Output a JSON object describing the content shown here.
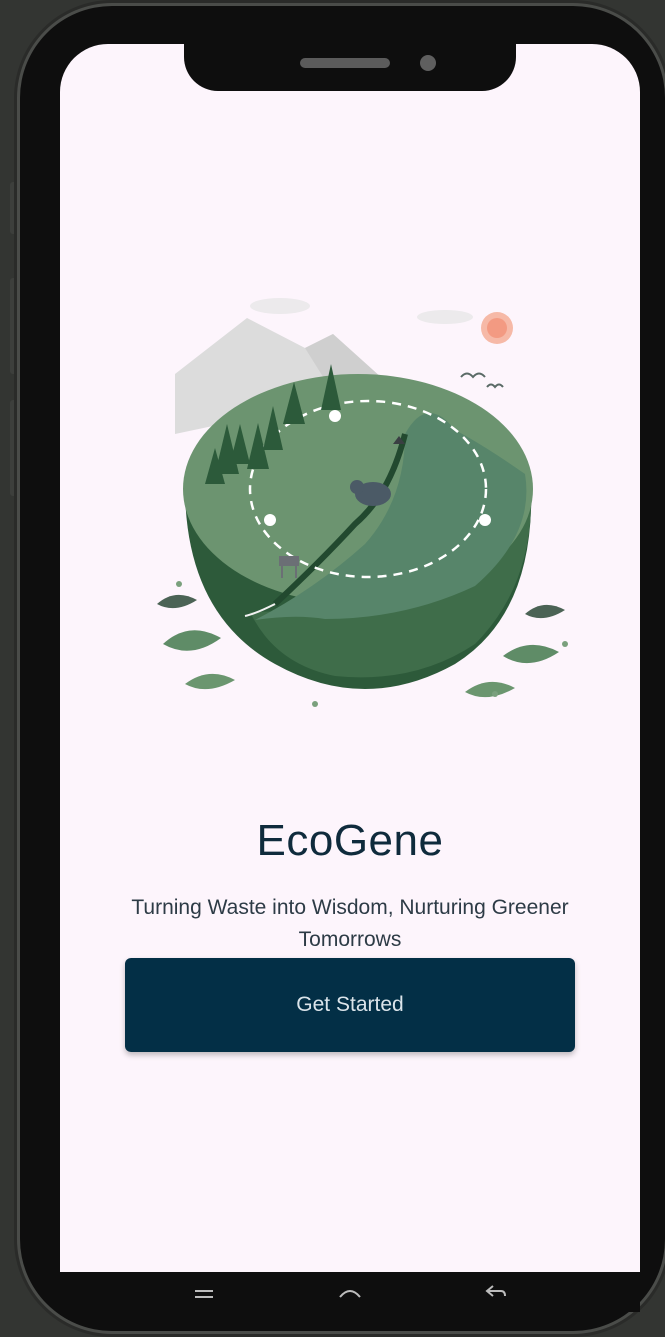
{
  "app": {
    "title": "EcoGene",
    "tagline": "Turning Waste into Wisdom, Nurturing Greener Tomorrows",
    "cta_label": "Get Started"
  },
  "icons": {
    "illustration": "earth-ecosystem-illustration",
    "nav_recents": "recents-icon",
    "nav_home": "home-icon",
    "nav_back": "back-icon"
  },
  "colors": {
    "background": "#fdf5fc",
    "primary": "#032f46",
    "title_text": "#0f2b3c",
    "illustration_green": "#4d7c56"
  }
}
